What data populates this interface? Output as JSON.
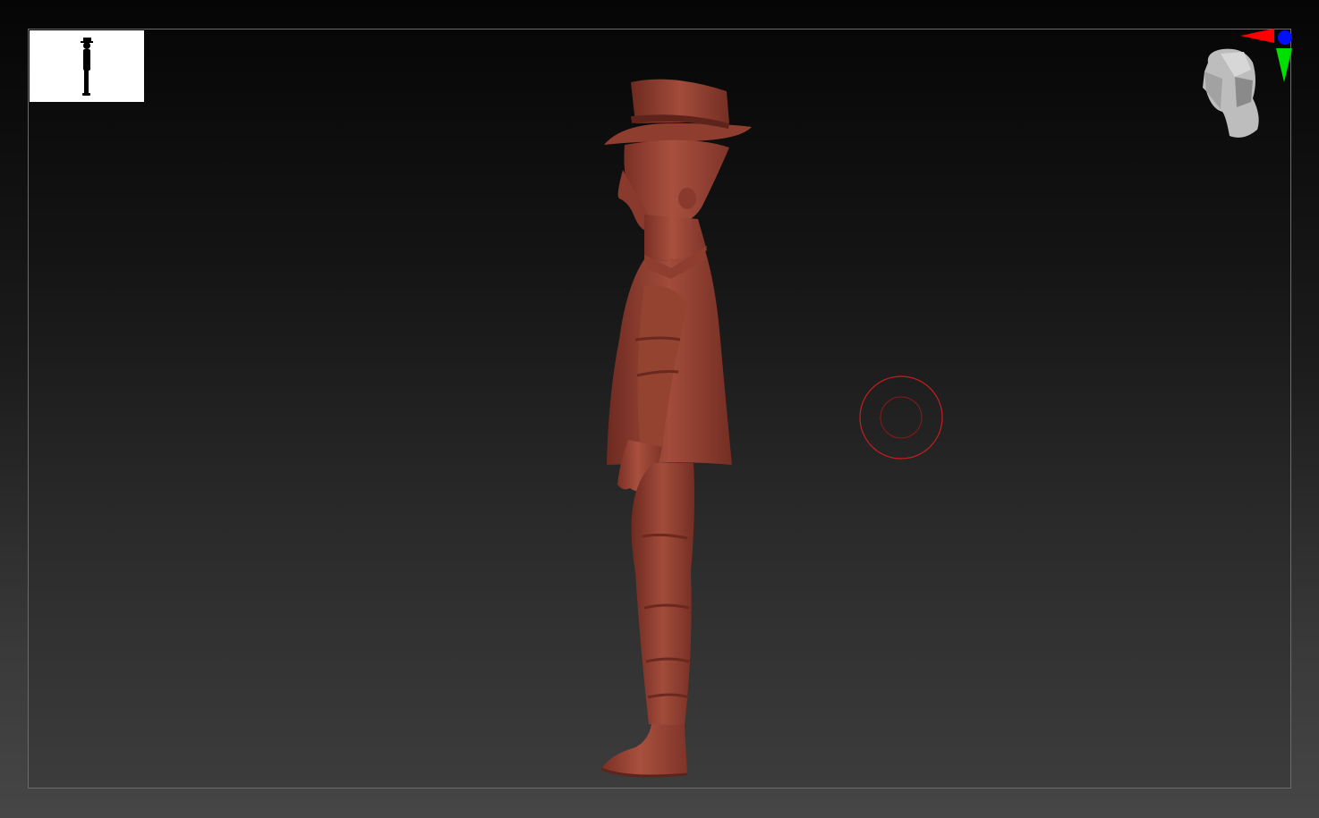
{
  "app": {
    "kind": "3d-sculpting-viewport"
  },
  "viewport": {
    "background_top": "#070707",
    "background_bottom": "#3c3c3c",
    "border_color": "#6a6a6a"
  },
  "model": {
    "icon": "sculpt-figure-side-view",
    "material_color": "#9e4a3c",
    "highlight_color": "#c26a58",
    "shadow_color": "#5e241c"
  },
  "thumbnail": {
    "icon": "silhouette-thumbnail",
    "background": "#ffffff",
    "silhouette_color": "#000000"
  },
  "brush": {
    "icon": "brush-cursor",
    "color": "#c81e1e"
  },
  "gizmo": {
    "icon": "navigation-head-gizmo",
    "x_axis_color": "#ff0000",
    "y_axis_color": "#00e000",
    "z_axis_color": "#0010ff",
    "head_color": "#bdbdbd"
  }
}
